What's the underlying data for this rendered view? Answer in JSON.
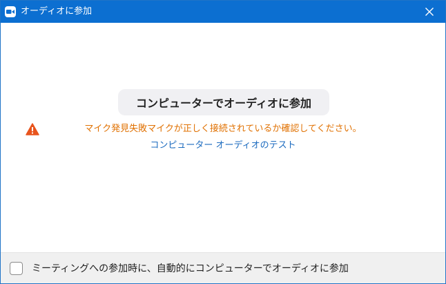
{
  "window": {
    "title": "オーディオに参加",
    "accent": "#0c6fd1"
  },
  "main": {
    "join_button_label": "コンピューターでオーディオに参加",
    "warning_text": "マイク発見失敗マイクが正しく接続されているか確認してください。",
    "warning_color": "#e07000",
    "test_link_label": "コンピューター オーディオのテスト"
  },
  "footer": {
    "auto_join_label": "ミーティングへの参加時に、自動的にコンピューターでオーディオに参加",
    "auto_join_checked": false
  },
  "icons": {
    "app": "video-camera-icon",
    "close": "close-icon",
    "warning": "warning-triangle-icon"
  }
}
